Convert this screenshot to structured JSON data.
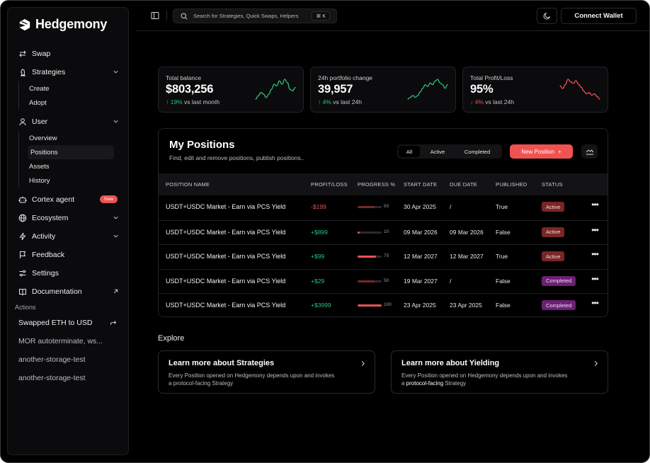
{
  "app": {
    "brand": "Hedgemony"
  },
  "colors": {
    "accent": "#f05252",
    "positive": "#2ec27e",
    "negative": "#f05252",
    "active_badge": "#7a2626",
    "completed_badge": "#6b2173"
  },
  "sidebar": {
    "items": [
      {
        "label": "Swap",
        "icon": "swap-icon"
      },
      {
        "label": "Strategies",
        "icon": "chess-knight-icon",
        "expandable": true,
        "children": [
          "Create",
          "Adopt"
        ]
      },
      {
        "label": "User",
        "icon": "user-icon",
        "expandable": true,
        "children": [
          "Overview",
          "Positions",
          "Assets",
          "History"
        ],
        "active_child": "Positions"
      },
      {
        "label": "Cortex agent",
        "icon": "bot-icon",
        "badge": "New"
      },
      {
        "label": "Ecosystem",
        "icon": "globe-icon",
        "expandable": true
      },
      {
        "label": "Activity",
        "icon": "lightning-icon",
        "expandable": true
      },
      {
        "label": "Feedback",
        "icon": "flag-icon"
      },
      {
        "label": "Settings",
        "icon": "sliders-icon"
      },
      {
        "label": "Documentation",
        "icon": "book-icon",
        "external": true
      }
    ],
    "actions_label": "Actions",
    "actions": [
      "Swapped ETH to USD",
      "MOR autoterminate, ws...",
      "another-storage-test",
      "another-storage-test"
    ]
  },
  "topbar": {
    "search_placeholder": "Search for Strategies, Quick Swaps, Helpers",
    "search_shortcut": "⌘ K",
    "connect_label": "Connect Wallet"
  },
  "stats": [
    {
      "label": "Total balance",
      "value": "$803,256",
      "delta": "19%",
      "direction": "up",
      "suffix": "vs last month",
      "trend": [
        3,
        5,
        7,
        6,
        4,
        6,
        9,
        12,
        11,
        14,
        12,
        15,
        13,
        9,
        8,
        10
      ]
    },
    {
      "label": "24h portfolio change",
      "value": "39,957",
      "delta": "4%",
      "direction": "up",
      "suffix": "vs last 24h",
      "trend": [
        4,
        5,
        6,
        5,
        6,
        8,
        10,
        12,
        11,
        13,
        12,
        14,
        15,
        13,
        12,
        10,
        12
      ]
    },
    {
      "label": "Total Profit/Loss",
      "value": "95%",
      "delta": "4%",
      "direction": "down",
      "suffix": "vs last 24h",
      "trend": [
        11,
        9,
        12,
        16,
        14,
        13,
        15,
        12,
        10,
        7,
        5,
        6,
        4,
        5,
        3,
        1
      ]
    }
  ],
  "positions": {
    "title": "My Positions",
    "subtitle": "Find, edit and remove positions, publish positions..",
    "filters": [
      "All",
      "Active",
      "Completed"
    ],
    "selected_filter": "All",
    "new_button": "New Position",
    "columns": [
      "POSITION NAME",
      "PROFIT/LOSS",
      "PROGRESS %",
      "START DATE",
      "DUE DATE",
      "PUBLISHED",
      "STATUS"
    ],
    "rows": [
      {
        "name": "USDT+USDC Market - Earn via PCS Yield",
        "pl": "-$199",
        "pl_sign": "neg",
        "progress": 50,
        "progress_dim": true,
        "start": "30 Apr 2025",
        "due": "/",
        "published": "True",
        "status": "Active"
      },
      {
        "name": "USDT+USDC Market - Earn via PCS Yield",
        "pl": "+$899",
        "pl_sign": "pos",
        "progress": 10,
        "progress_dim": false,
        "start": "09 Mar 2026",
        "due": "09 Mar 2026",
        "published": "False",
        "status": "Active"
      },
      {
        "name": "USDT+USDC Market - Earn via PCS Yield",
        "pl": "+$99",
        "pl_sign": "pos",
        "progress": 75,
        "progress_dim": false,
        "start": "12 Mar 2027",
        "due": "12 Mar 2027",
        "published": "True",
        "status": "Active"
      },
      {
        "name": "USDT+USDC Market - Earn via PCS Yield",
        "pl": "+$29",
        "pl_sign": "pos",
        "progress": 50,
        "progress_dim": true,
        "start": "19 Mar 2027",
        "due": "/",
        "published": "False",
        "status": "Completed"
      },
      {
        "name": "USDT+USDC Market - Earn via PCS Yield",
        "pl": "+$3999",
        "pl_sign": "pos",
        "progress": 100,
        "progress_dim": false,
        "start": "23 Apr 2025",
        "due": "23 Apr 2025",
        "published": "False",
        "status": "Completed"
      }
    ]
  },
  "explore": {
    "title": "Explore",
    "cards": [
      {
        "title": "Learn more about Strategies",
        "desc_pre": "Every Position opened on Hedgemony depends upon and invokes a ",
        "desc_hl": "protocol-facing",
        "desc_post": " Strategy",
        "highlight": false
      },
      {
        "title": "Learn more about Yielding",
        "desc_pre": "Every Position opened on Hedgemony depends upon and invokes a ",
        "desc_hl": "protocol-facing",
        "desc_post": " Strategy",
        "highlight": true
      }
    ]
  }
}
